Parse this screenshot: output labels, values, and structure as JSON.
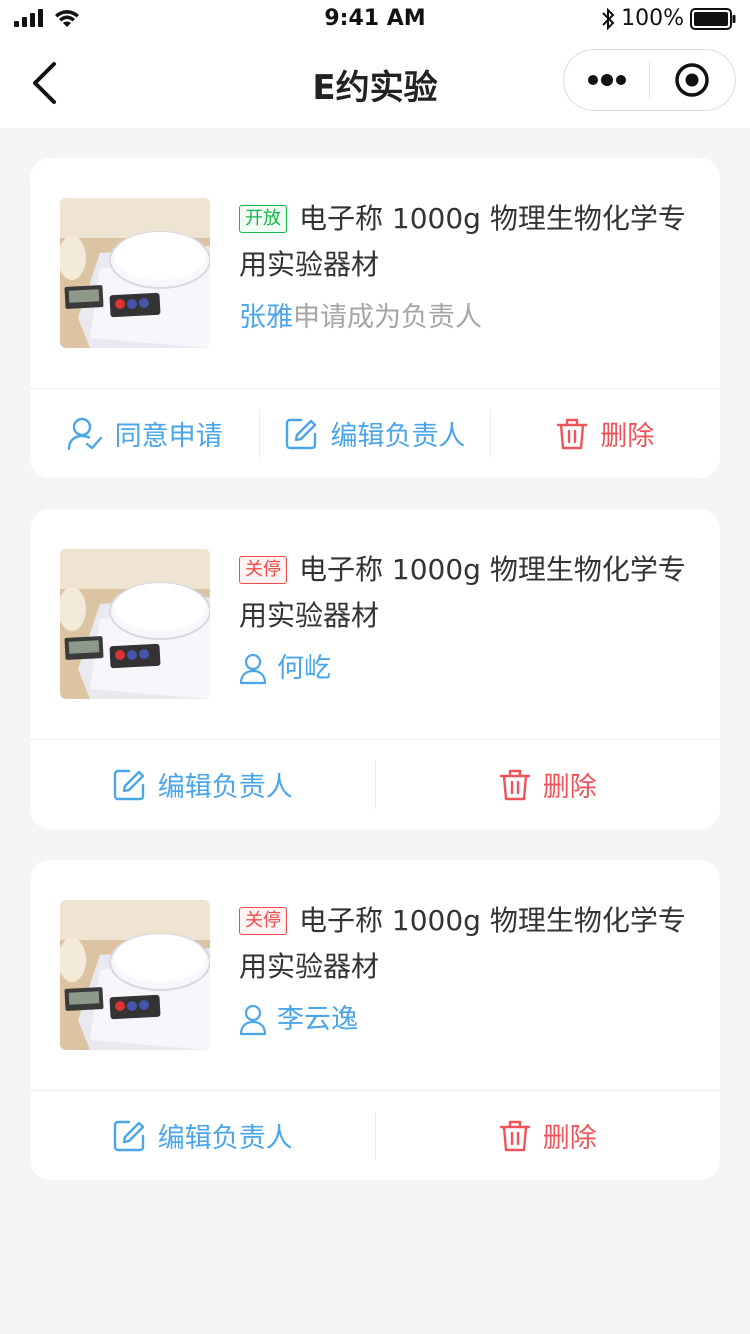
{
  "status_bar": {
    "time": "9:41 AM",
    "battery": "100%"
  },
  "nav": {
    "title": "E约实验",
    "back_icon": "chevron-left-icon",
    "more_icon": "more-dots-icon",
    "close_icon": "target-circle-icon"
  },
  "colors": {
    "accent_blue": "#4aa6e9",
    "danger_red": "#f0545a",
    "open_green": "#18b54b"
  },
  "cards": [
    {
      "status": "开放",
      "title": "电子称 1000g 物理生物化学专用实验器材",
      "person_name": "张雅",
      "person_suffix": "申请成为负责人",
      "actions": {
        "approve": "同意申请",
        "edit": "编辑负责人",
        "delete": "删除"
      }
    },
    {
      "status": "关停",
      "title": "电子称 1000g 物理生物化学专用实验器材",
      "person_name": "何屹",
      "actions": {
        "edit": "编辑负责人",
        "delete": "删除"
      }
    },
    {
      "status": "关停",
      "title": "电子称 1000g 物理生物化学专用实验器材",
      "person_name": "李云逸",
      "actions": {
        "edit": "编辑负责人",
        "delete": "删除"
      }
    }
  ]
}
